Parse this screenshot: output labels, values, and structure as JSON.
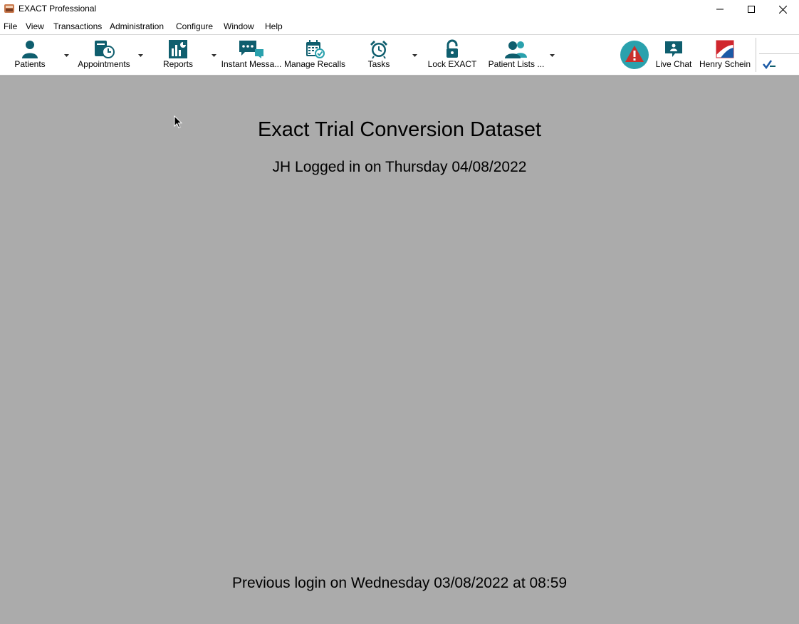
{
  "window": {
    "title": "EXACT Professional"
  },
  "menu": [
    "File",
    "View",
    "Transactions",
    "Administration",
    "Configure",
    "Window",
    "Help"
  ],
  "toolbar": {
    "patients": "Patients",
    "appointments": "Appointments",
    "reports": "Reports",
    "instant_messages": "Instant Messa...",
    "manage_recalls": "Manage Recalls",
    "tasks": "Tasks",
    "lock_exact": "Lock EXACT",
    "patient_lists": "Patient Lists ...",
    "live_chat": "Live Chat",
    "henry_schein": "Henry Schein"
  },
  "main": {
    "dataset_title": "Exact Trial Conversion Dataset",
    "logged_in": "JH Logged in on Thursday 04/08/2022",
    "previous_login": "Previous login on Wednesday 03/08/2022 at 08:59"
  },
  "colors": {
    "icon_teal": "#0f5e6e",
    "background": "#ababab",
    "alert_circle": "#2aa1ad",
    "alert_triangle": "#c9302c",
    "brand_red": "#d0262d",
    "brand_blue": "#1c5aa6"
  }
}
